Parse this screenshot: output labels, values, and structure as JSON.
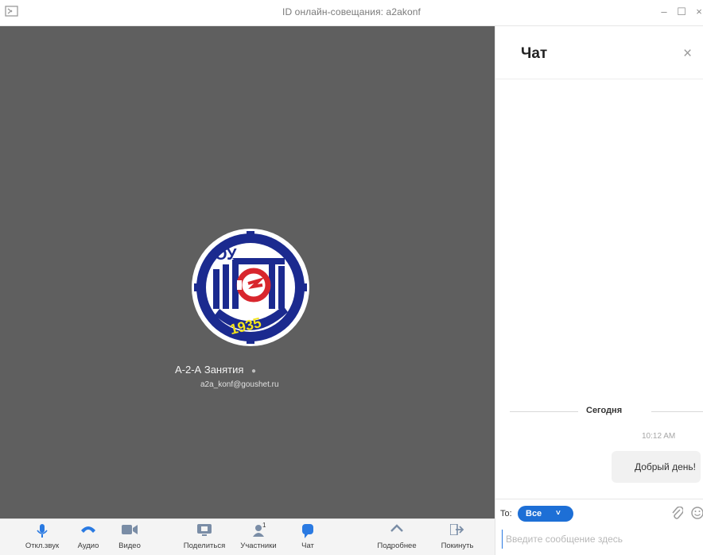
{
  "window": {
    "title": "ID онлайн-совещания: a2akonf",
    "minimize_glyph": "–",
    "maximize_glyph": "☐",
    "close_glyph": "×"
  },
  "participant": {
    "name": "А-2-А Занятия",
    "email": "a2a_konf@goushet.ru",
    "avatar_text": "1935",
    "avatar_letters": "ОУ"
  },
  "toolbar": {
    "items": [
      {
        "label": "Откл.звук",
        "icon": "mic-icon"
      },
      {
        "label": "Аудио",
        "icon": "phone-icon"
      },
      {
        "label": "Видео",
        "icon": "video-camera-icon"
      },
      {
        "label": "Поделиться",
        "icon": "share-screen-icon"
      },
      {
        "label": "Участники",
        "icon": "participants-icon",
        "badge": "1"
      },
      {
        "label": "Чат",
        "icon": "chat-icon"
      },
      {
        "label": "Подробнее",
        "icon": "chevron-up-icon"
      },
      {
        "label": "Покинуть",
        "icon": "leave-icon"
      }
    ]
  },
  "chat": {
    "title": "Чат",
    "close_glyph": "×",
    "date_separator": "Сегодня",
    "messages": [
      {
        "time": "10:12 AM",
        "text": "Добрый день!"
      }
    ],
    "to_label": "To:",
    "recipient": "Все",
    "recipient_chevron": "˅",
    "input_placeholder": "Введите сообщение здесь"
  },
  "colors": {
    "accent": "#1d6fd6",
    "video_bg": "#5f5f5f",
    "toolbar_bg": "#f4f4f4"
  }
}
